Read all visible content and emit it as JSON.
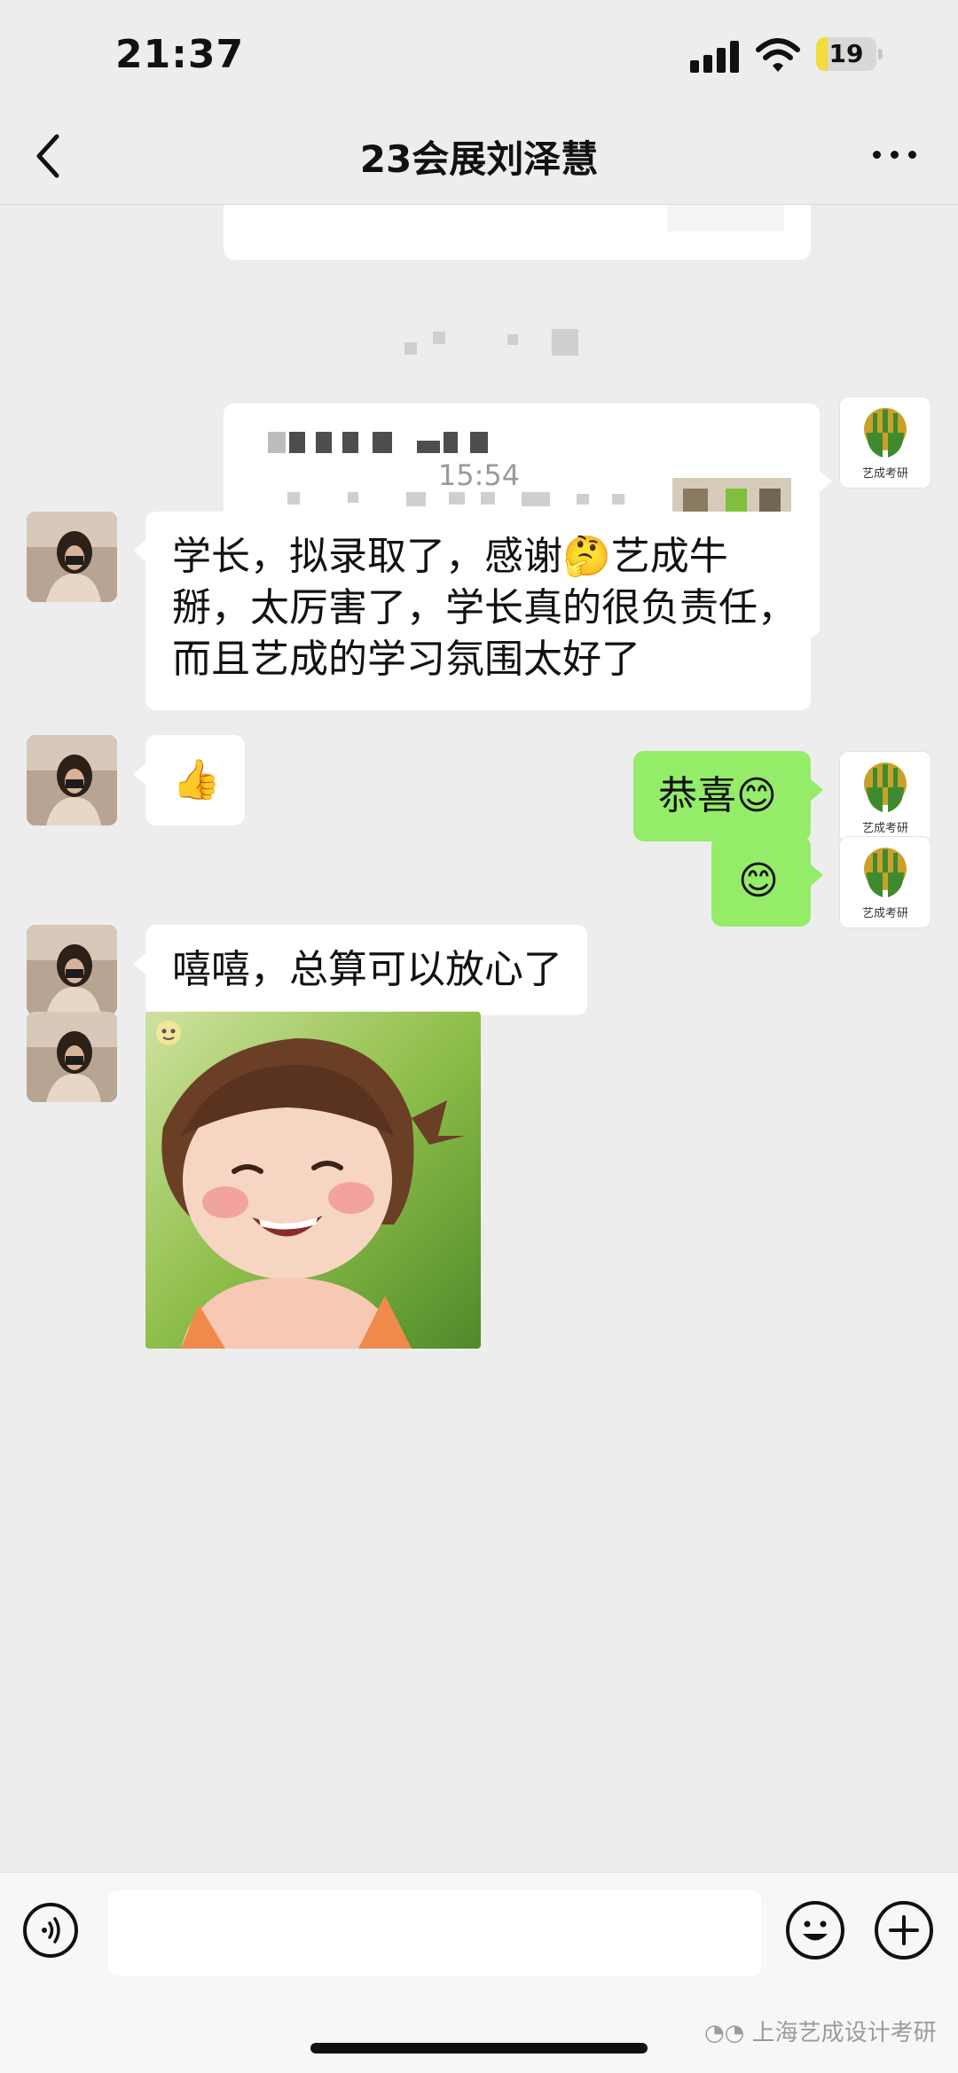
{
  "status_bar": {
    "time": "21:37",
    "battery_level": "19",
    "battery_fraction": 0.19,
    "icons": [
      "signal-icon",
      "wifi-icon",
      "battery-icon"
    ]
  },
  "nav": {
    "title": "23会展刘泽慧",
    "back_icon": "chevron-left-icon",
    "more_icon": "more-dots-icon"
  },
  "messages": {
    "timestamp": "15:54",
    "msg1": "学长，拟录取了，感谢🤔艺成牛掰，太厉害了，学长真的很负责任，而且艺成的学习氛围太好了",
    "msg1_line1": "学长，拟录取了，感谢🤔艺成牛",
    "msg1_line2": "掰，太厉害了，学长真的很负责任，",
    "msg1_line3": "而且艺成的学习氛围太好了",
    "msg2": "👍",
    "msg3": "恭喜😊",
    "msg4": "😊",
    "msg5": "嘻嘻，总算可以放心了",
    "logo_text": "艺成考研"
  },
  "input_bar": {
    "text_value": "",
    "voice_icon": "voice-icon",
    "emoji_icon": "emoji-icon",
    "plus_icon": "plus-icon"
  },
  "watermark": "上海艺成设计考研",
  "colors": {
    "background": "#ededed",
    "sent_bubble": "#95ec69",
    "received_bubble": "#ffffff",
    "logo_green": "#3f8a2f",
    "logo_gold": "#c9a12a"
  }
}
